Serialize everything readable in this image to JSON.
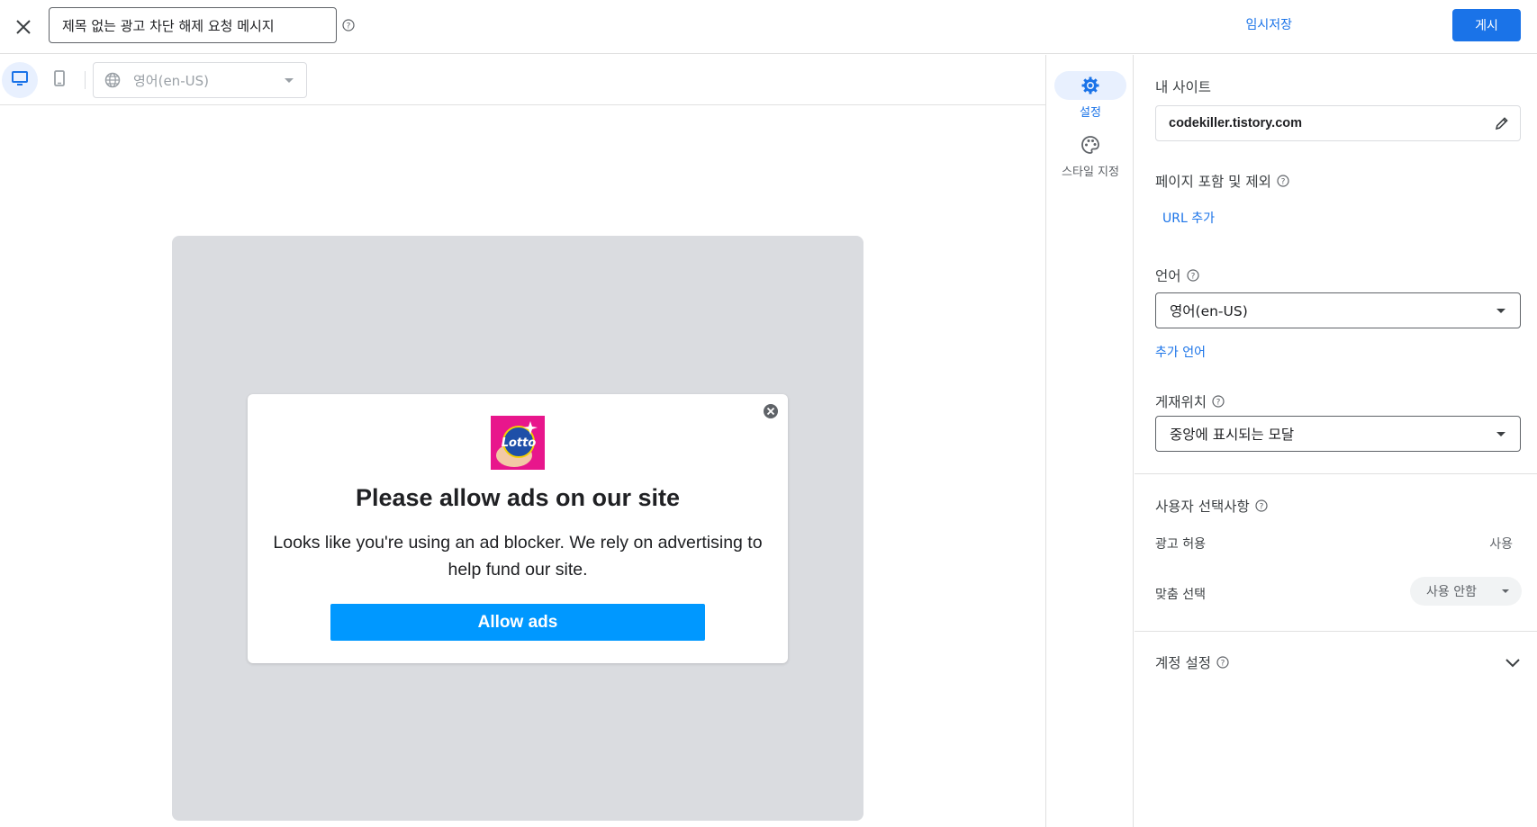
{
  "header": {
    "title_value": "제목 없는 광고 차단 해제 요청 메시지",
    "draft_label": "임시저장",
    "publish_label": "게시"
  },
  "preview_toolbar": {
    "language_value": "영어(en-US)"
  },
  "modal": {
    "logo_text": "Lotto",
    "title": "Please allow ads on our site",
    "body": "Looks like you're using an ad blocker. We rely on advertising to help fund our site.",
    "button_label": "Allow ads"
  },
  "rail": {
    "settings_label": "설정",
    "style_label": "스타일 지정"
  },
  "panel": {
    "my_site_label": "내 사이트",
    "site_value": "codekiller.tistory.com",
    "pages_label": "페이지 포함 및 제외",
    "add_url_label": "URL 추가",
    "language_label": "언어",
    "language_value": "영어(en-US)",
    "add_language_label": "추가 언어",
    "placement_label": "게재위치",
    "placement_value": "중앙에 표시되는 모달",
    "user_choices_label": "사용자 선택사항",
    "allow_ads_label": "광고 허용",
    "allow_ads_value": "사용",
    "custom_choice_label": "맞춤 선택",
    "custom_choice_value": "사용 안함",
    "account_settings_label": "계정 설정"
  },
  "colors": {
    "accent": "#1a73e8",
    "allow_button": "#0098ff",
    "canvas": "#dadce0",
    "logo_bg": "#e8168c"
  }
}
